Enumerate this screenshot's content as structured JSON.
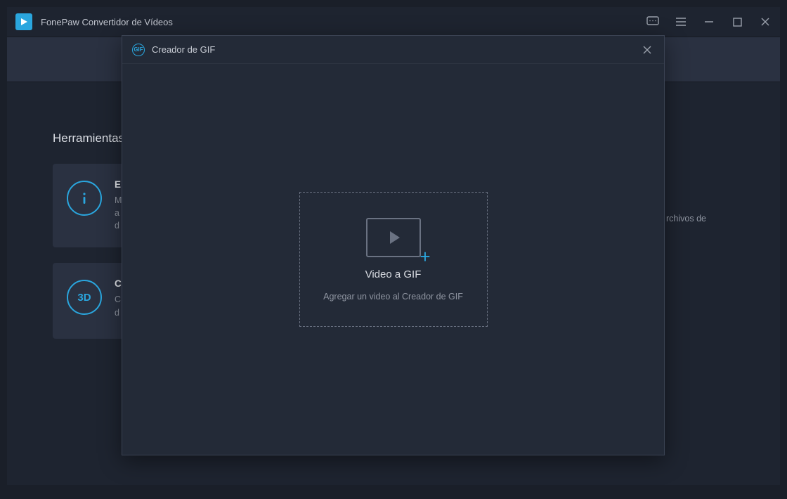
{
  "app": {
    "title": "FonePaw Convertidor de Vídeos",
    "icon_name": "play-icon"
  },
  "window_controls": {
    "chat": "chat",
    "menu": "menu",
    "min": "minimize",
    "max": "maximize",
    "close": "close"
  },
  "section": {
    "title": "Herramientas"
  },
  "cards": [
    {
      "icon_label": "i",
      "title_prefix": "E",
      "desc_l1": "M",
      "desc_l2": "a",
      "desc_l3": "d"
    },
    {
      "icon_label": "3D",
      "title_prefix": "C",
      "desc_l1": "C",
      "desc_l2": "d"
    }
  ],
  "right_bg_fragment": "rchivos de",
  "modal": {
    "badge": "GIF",
    "title": "Creador de GIF",
    "drop_title": "Video a GIF",
    "drop_subtitle": "Agregar un video al Creador de GIF"
  }
}
